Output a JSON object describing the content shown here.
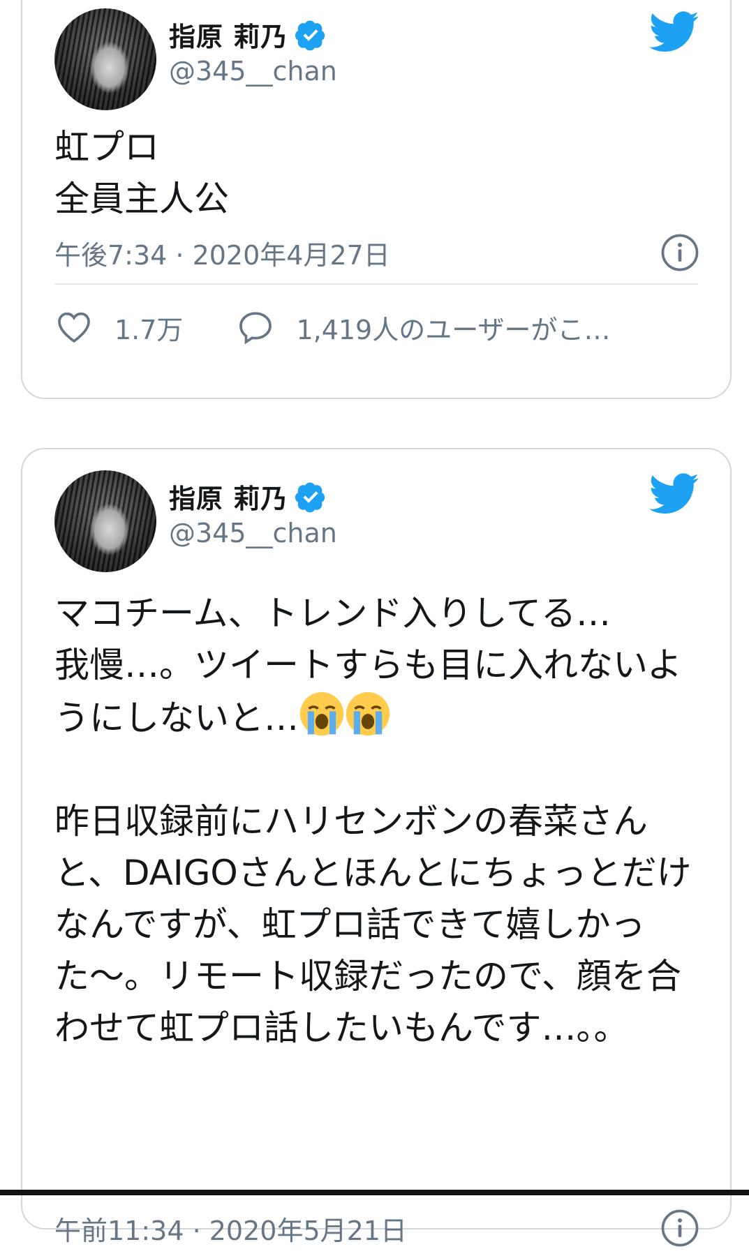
{
  "tweets": [
    {
      "display_name": "指原 莉乃",
      "handle": "@345__chan",
      "text": "虹プロ\n全員主人公",
      "timestamp": "午後7:34 · 2020年4月27日",
      "likes": "1.7万",
      "replies": "1,419人のユーザーがこ…"
    },
    {
      "display_name": "指原 莉乃",
      "handle": "@345__chan",
      "text_part1": "マコチーム、トレンド入りしてる…\n我慢…。ツイートすらも目に入れないようにしないと…",
      "text_part2": "\n\n昨日収録前にハリセンボンの春菜さんと、DAIGOさんとほんとにちょっとだけなんですが、虹プロ話できて嬉しかった〜。リモート収録だったので、顔を合わせて虹プロ話したいもんです…。。",
      "emoji": "loudly-crying-face",
      "timestamp": "午前11:34 · 2020年5月21日"
    }
  ],
  "colors": {
    "twitter_blue": "#1da1f2",
    "secondary_text": "#657786",
    "border": "#d3d7db"
  },
  "icons": [
    "verified-badge-icon",
    "twitter-bird-icon",
    "info-icon",
    "heart-icon",
    "reply-bubble-icon",
    "crying-emoji-icon"
  ]
}
